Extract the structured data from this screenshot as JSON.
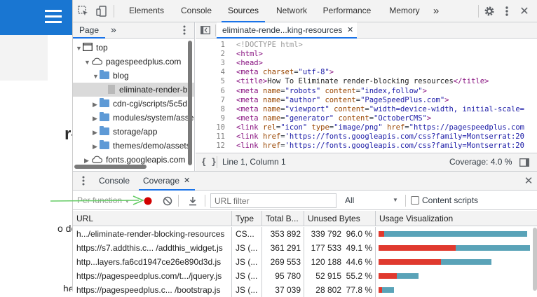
{
  "site": {
    "title_fragment": "r-",
    "body_fragment": "o do is",
    "bottom_fragment": "he"
  },
  "devtools": {
    "main_tabs": [
      "Elements",
      "Console",
      "Sources",
      "Network",
      "Performance",
      "Memory"
    ],
    "more_tabs_label": "»",
    "navigator": {
      "tab": "Page",
      "more": "»",
      "tree": [
        {
          "label": "top",
          "indent": 0,
          "kind": "frame",
          "open": true
        },
        {
          "label": "pagespeedplus.com",
          "indent": 1,
          "kind": "cloud",
          "open": true
        },
        {
          "label": "blog",
          "indent": 2,
          "kind": "folder",
          "open": true
        },
        {
          "label": "eliminate-render-bl",
          "indent": 3,
          "kind": "file",
          "selected": true
        },
        {
          "label": "cdn-cgi/scripts/5c5d",
          "indent": 2,
          "kind": "folder",
          "open": false
        },
        {
          "label": "modules/system/asse",
          "indent": 2,
          "kind": "folder",
          "open": false
        },
        {
          "label": "storage/app",
          "indent": 2,
          "kind": "folder",
          "open": false
        },
        {
          "label": "themes/demo/assets",
          "indent": 2,
          "kind": "folder",
          "open": false
        },
        {
          "label": "fonts.googleapis.com",
          "indent": 1,
          "kind": "cloud",
          "open": false
        }
      ]
    },
    "editor": {
      "tab_label": "eliminate-rende...king-resources",
      "lines": [
        {
          "n": "1",
          "html": "<span class='cm'>&lt;!DOCTYPE html&gt;</span>"
        },
        {
          "n": "2",
          "html": "<span class='tg'>&lt;html&gt;</span>"
        },
        {
          "n": "3",
          "html": "<span class='tg'>&lt;head&gt;</span>"
        },
        {
          "n": "4",
          "html": "<span class='tg'>&lt;meta</span> <span class='at'>charset</span>=<span class='vl'>\"utf-8\"</span><span class='tg'>&gt;</span>"
        },
        {
          "n": "5",
          "html": "<span class='tg'>&lt;title&gt;</span><span class='tx'>How To Eliminate render-blocking resources</span><span class='tg'>&lt;/title&gt;</span>"
        },
        {
          "n": "6",
          "html": "<span class='tg'>&lt;meta</span> <span class='at'>name</span>=<span class='vl'>\"robots\"</span> <span class='at'>content</span>=<span class='vl'>\"index,follow\"</span><span class='tg'>&gt;</span>"
        },
        {
          "n": "7",
          "html": "<span class='tg'>&lt;meta</span> <span class='at'>name</span>=<span class='vl'>\"author\"</span> <span class='at'>content</span>=<span class='vl'>\"PageSpeedPlus.com\"</span><span class='tg'>&gt;</span>"
        },
        {
          "n": "8",
          "html": "<span class='tg'>&lt;meta</span> <span class='at'>name</span>=<span class='vl'>\"viewport\"</span> <span class='at'>content</span>=<span class='vl'>\"width=device-width, initial-scale=</span>"
        },
        {
          "n": "9",
          "html": "<span class='tg'>&lt;meta</span> <span class='at'>name</span>=<span class='vl'>\"generator\"</span> <span class='at'>content</span>=<span class='vl'>\"OctoberCMS\"</span><span class='tg'>&gt;</span>"
        },
        {
          "n": "10",
          "html": "<span class='tg'>&lt;link</span> <span class='at'>rel</span>=<span class='vl'>\"icon\"</span> <span class='at'>type</span>=<span class='vl'>\"image/png\"</span> <span class='at'>href</span>=<span class='vl'>\"https://pagespeedplus.com</span>"
        },
        {
          "n": "11",
          "html": "<span class='tg'>&lt;link</span> <span class='at'>href</span>=<span class='vl'>'https://fonts.googleapis.com/css?family=Montserrat:20</span>"
        },
        {
          "n": "12",
          "html": "<span class='tg'>&lt;link</span> <span class='at'>href</span>=<span class='vl'>'https://fonts.googleapis.com/css?family=Montserrat:20</span>"
        }
      ],
      "status_position": "Line 1, Column 1",
      "status_coverage": "Coverage: 4.0 %",
      "format_label": "{ }"
    },
    "drawer": {
      "tabs": [
        "Console",
        "Coverage"
      ],
      "active_tab": "Coverage",
      "toolbar": {
        "per_function": "Per function",
        "url_filter_placeholder": "URL filter",
        "type_select": "All",
        "content_scripts": "Content scripts"
      },
      "columns": [
        "URL",
        "Type",
        "Total B...",
        "Unused Bytes",
        "Usage Visualization"
      ],
      "rows": [
        {
          "url": "h.../eliminate-render-blocking-resources",
          "type": "CS...",
          "total": "353 892",
          "unused": "339 792",
          "pct": "96.0 %",
          "total_bytes": 353892,
          "used_fraction": 0.04
        },
        {
          "url": "https://s7.addthis.c... /addthis_widget.js",
          "type": "JS (...",
          "total": "361 291",
          "unused": "177 533",
          "pct": "49.1 %",
          "total_bytes": 361291,
          "used_fraction": 0.509
        },
        {
          "url": "http...layers.fa6cd1947ce26e890d3d.js",
          "type": "JS (...",
          "total": "269 553",
          "unused": "120 188",
          "pct": "44.6 %",
          "total_bytes": 269553,
          "used_fraction": 0.554
        },
        {
          "url": "https://pagespeedplus.com/t.../jquery.js",
          "type": "JS (...",
          "total": "95 780",
          "unused": "52 915",
          "pct": "55.2 %",
          "total_bytes": 95780,
          "used_fraction": 0.448
        },
        {
          "url": "https://pagespeedplus.c... /bootstrap.js",
          "type": "JS (...",
          "total": "37 039",
          "unused": "28 802",
          "pct": "77.8 %",
          "total_bytes": 37039,
          "used_fraction": 0.222
        }
      ]
    },
    "colors": {
      "used": "#e0392e",
      "unused": "#5aa3b8",
      "accent": "#1a73e8",
      "record": "#d20000"
    }
  }
}
